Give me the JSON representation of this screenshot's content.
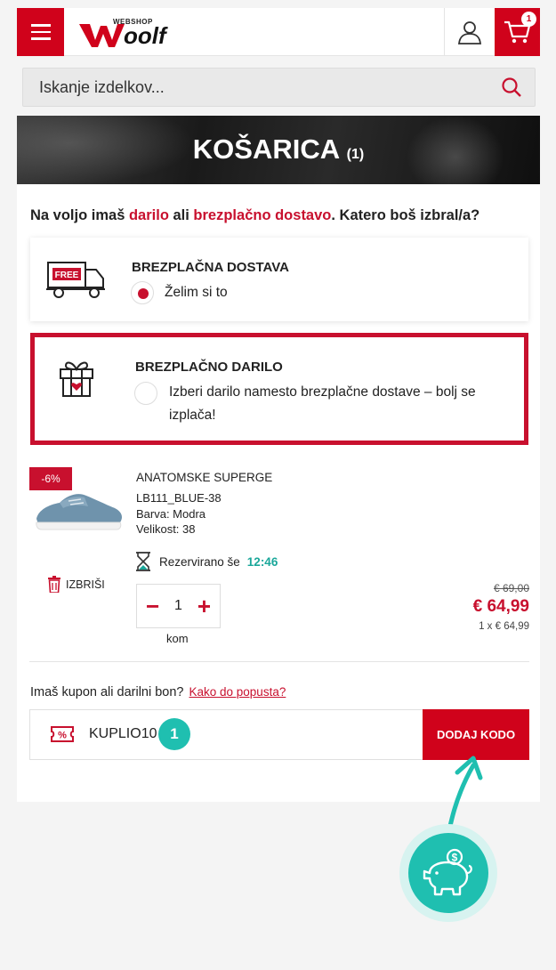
{
  "header": {
    "logo_text": "oolf",
    "logo_tagline": "WEBSHOP",
    "cart_count": "1"
  },
  "search": {
    "placeholder": "Iskanje izdelkov..."
  },
  "banner": {
    "title": "KOŠARICA",
    "count": "(1)"
  },
  "offer": {
    "prefix": "Na voljo imaš ",
    "gift_word": "darilo",
    "middle": " ali ",
    "shipping_word": "brezplačno dostavo",
    "suffix": ". Katero boš izbral/a?"
  },
  "options": [
    {
      "title": "BREZPLAČNA DOSTAVA",
      "text": "Želim si to",
      "selected": true,
      "icon": "free-truck-icon",
      "icon_label": "FREE"
    },
    {
      "title": "BREZPLAČNO DARILO",
      "text_line1": "Izberi darilo namesto brezplačne dostave – bolj se",
      "text_line2": "izplača!",
      "selected": false,
      "icon": "gift-box-icon"
    }
  ],
  "product": {
    "discount": "-6%",
    "name": "ANATOMSKE SUPERGE",
    "sku": "LB111_BLUE-38",
    "color": "Barva: Modra",
    "size": "Velikost: 38",
    "reserved_label": "Rezervirano še",
    "reserved_time": "12:46",
    "delete_label": "IZBRIŠI",
    "quantity": "1",
    "unit": "kom",
    "price_old": "€ 69,00",
    "price_new": "€ 64,99",
    "price_unit": "1 x € 64,99"
  },
  "coupon": {
    "question": "Imaš kupon ali darilni bon?",
    "link": "Kako do popusta?",
    "value": "KUPLIO10",
    "step": "1",
    "button": "DODAJ KODO"
  },
  "colors": {
    "brand_red": "#d0021b",
    "accent_teal": "#1fbfb0"
  }
}
